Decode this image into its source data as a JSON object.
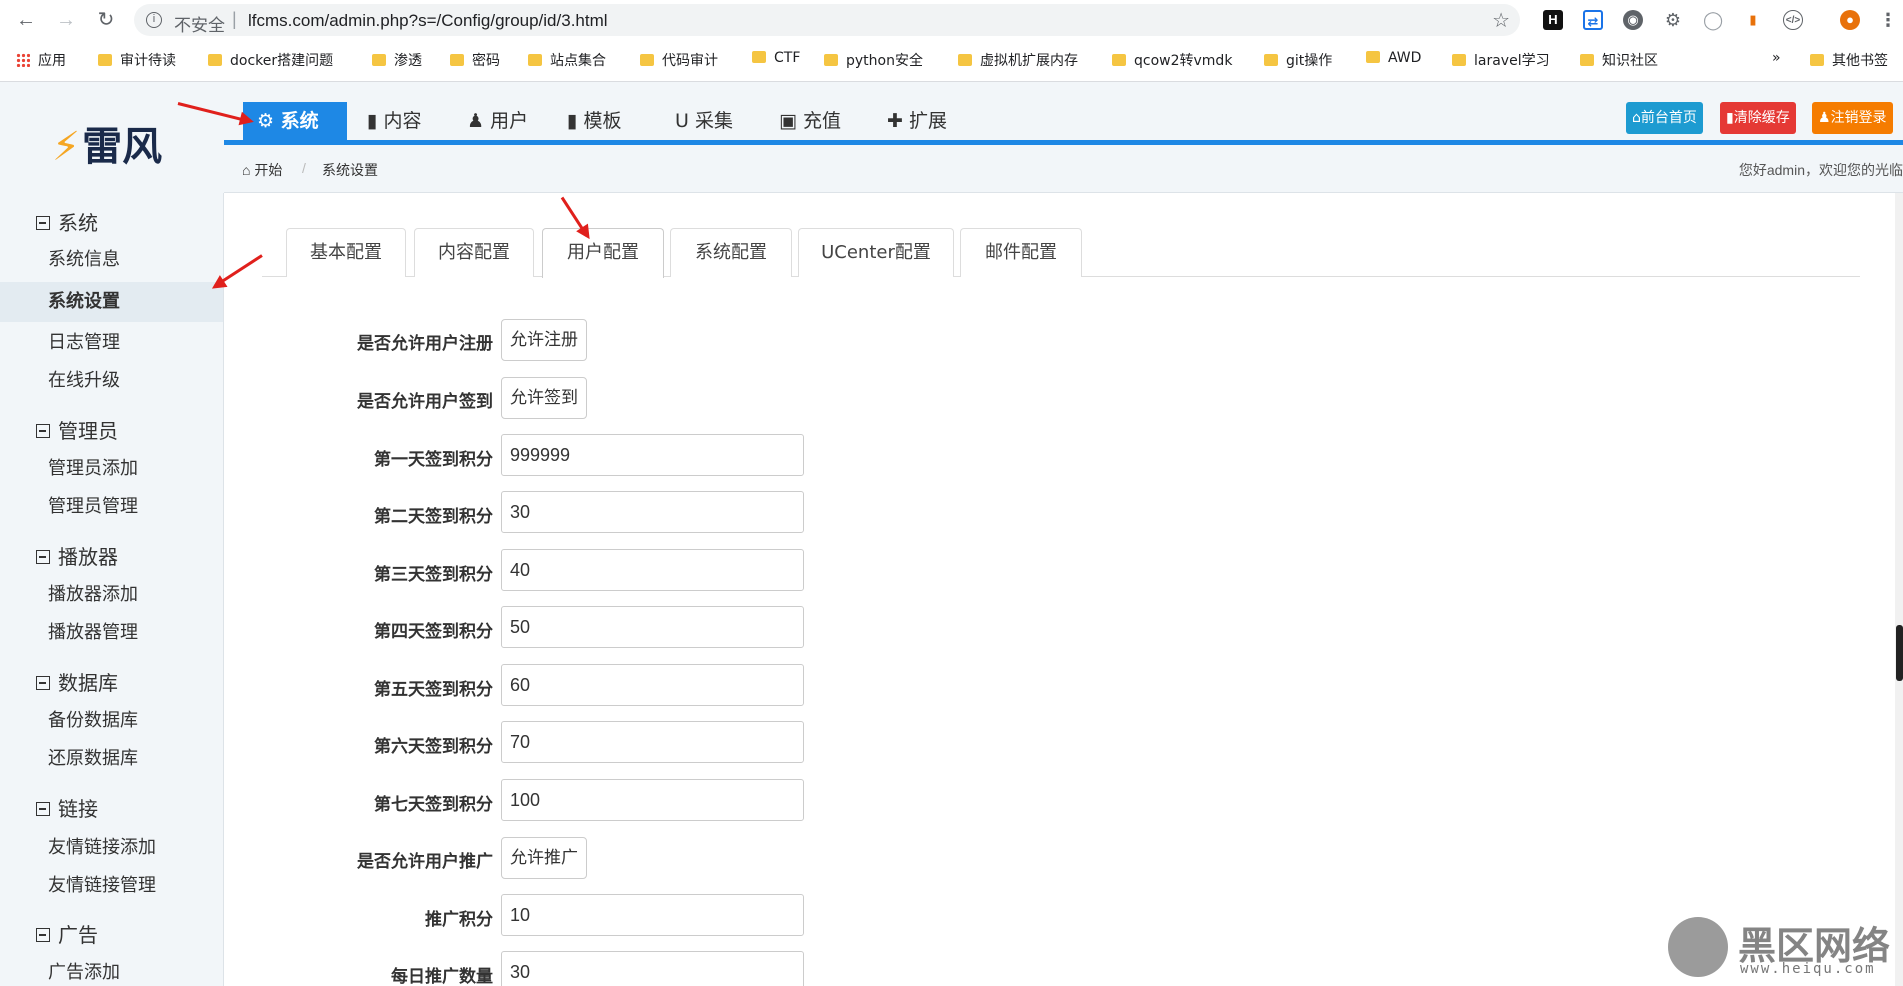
{
  "browser": {
    "insecure_label": "不安全",
    "url": "lfcms.com/admin.php?s=/Config/group/id/3.html",
    "bookmarks": [
      "应用",
      "审计待读",
      "docker搭建问题",
      "渗透",
      "密码",
      "站点集合",
      "代码审计",
      "CTF",
      "python安全",
      "虚拟机扩展内存",
      "qcow2转vmdk",
      "git操作",
      "AWD",
      "laravel学习",
      "知识社区",
      "»",
      "其他书签"
    ]
  },
  "brand": {
    "logo_text": "雷风",
    "accent": "#1e88e5"
  },
  "topnav": {
    "items": [
      "系统",
      "内容",
      "用户",
      "模板",
      "采集",
      "充值",
      "扩展"
    ],
    "active": "系统"
  },
  "topbuttons": {
    "home": "前台首页",
    "clear_cache": "清除缓存",
    "logout": "注销登录"
  },
  "breadcrumb": {
    "home": "开始",
    "current": "系统设置"
  },
  "welcome": "您好admin，欢迎您的光临",
  "sidebar": {
    "groups": [
      {
        "title": "系统",
        "items": [
          "系统信息",
          "系统设置",
          "日志管理",
          "在线升级"
        ]
      },
      {
        "title": "管理员",
        "items": [
          "管理员添加",
          "管理员管理"
        ]
      },
      {
        "title": "播放器",
        "items": [
          "播放器添加",
          "播放器管理"
        ]
      },
      {
        "title": "数据库",
        "items": [
          "备份数据库",
          "还原数据库"
        ]
      },
      {
        "title": "链接",
        "items": [
          "友情链接添加",
          "友情链接管理"
        ]
      },
      {
        "title": "广告",
        "items": [
          "广告添加"
        ]
      }
    ],
    "active_item": "系统设置"
  },
  "tabs": {
    "items": [
      "基本配置",
      "内容配置",
      "用户配置",
      "系统配置",
      "UCenter配置",
      "邮件配置"
    ],
    "active": "用户配置"
  },
  "form": [
    {
      "label": "是否允许用户注册",
      "type": "button",
      "value": "允许注册"
    },
    {
      "label": "是否允许用户签到",
      "type": "button",
      "value": "允许签到"
    },
    {
      "label": "第一天签到积分",
      "type": "input",
      "value": "999999"
    },
    {
      "label": "第二天签到积分",
      "type": "input",
      "value": "30"
    },
    {
      "label": "第三天签到积分",
      "type": "input",
      "value": "40"
    },
    {
      "label": "第四天签到积分",
      "type": "input",
      "value": "50"
    },
    {
      "label": "第五天签到积分",
      "type": "input",
      "value": "60"
    },
    {
      "label": "第六天签到积分",
      "type": "input",
      "value": "70"
    },
    {
      "label": "第七天签到积分",
      "type": "input",
      "value": "100"
    },
    {
      "label": "是否允许用户推广",
      "type": "button",
      "value": "允许推广"
    },
    {
      "label": "推广积分",
      "type": "input",
      "value": "10"
    },
    {
      "label": "每日推广数量",
      "type": "input",
      "value": "30"
    }
  ],
  "watermark": {
    "text": "黑区网络",
    "sub": "www.heiqu.com"
  }
}
